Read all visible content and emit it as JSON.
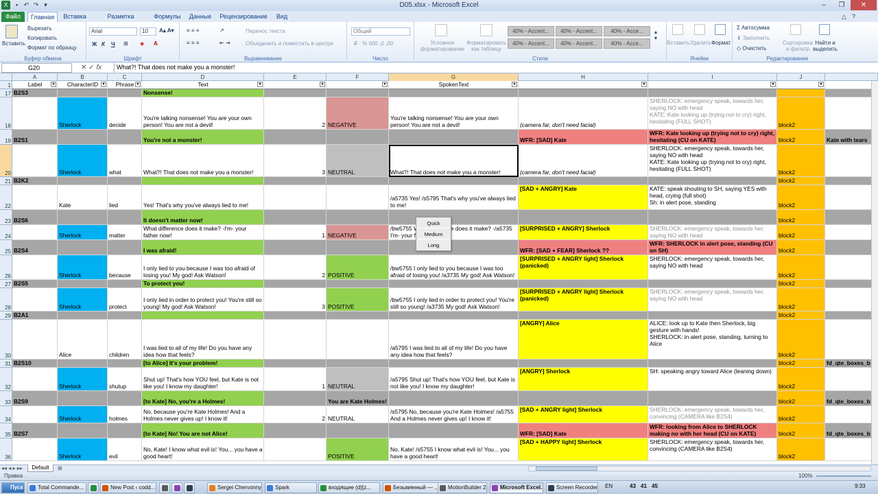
{
  "window": {
    "title": "D05.xlsx - Microsoft Excel"
  },
  "tabs": [
    "Файл",
    "Главная",
    "Вставка",
    "Разметка страницы",
    "Формулы",
    "Данные",
    "Рецензирование",
    "Вид"
  ],
  "ribbon": {
    "paste": "Вставить",
    "cut": "Вырезать",
    "copy": "Копировать",
    "format_painter": "Формат по образцу",
    "clipboard_group": "Буфер обмена",
    "font_name": "Arial",
    "font_size": "10",
    "font_group": "Шрифт",
    "wrap_text": "Перенос текста",
    "merge_center": "Объединить и поместить в центре",
    "alignment_group": "Выравнивание",
    "number_format": "Общий",
    "number_group": "Число",
    "conditional_formatting": "Условное форматирование",
    "format_as_table": "Форматировать как таблицу",
    "styles": [
      "40% - Accent...",
      "40% - Accent...",
      "40% - Acce...",
      "40% - Accent...",
      "40% - Accent...",
      "40% - Acce..."
    ],
    "styles_group": "Стили",
    "insert": "Вставить",
    "delete": "Удалить",
    "format": "Формат",
    "cells_group": "Ячейки",
    "autosum": "Автосумма",
    "fill": "Заполнить",
    "clear": "Очистить",
    "sort_filter": "Сортировка и фильтр",
    "find_select": "Найти и выделить",
    "editing_group": "Редактирование"
  },
  "formula_bar": {
    "name_box": "G20",
    "fx": "fx",
    "value": "What?! That does not make you a monster!"
  },
  "columns": [
    "A",
    "B",
    "C",
    "D",
    "E",
    "F",
    "G",
    "H",
    "I",
    "J"
  ],
  "header_row": {
    "num": "1",
    "cells": [
      "Label",
      "CharacterID",
      "Phrase",
      "Text",
      "",
      "",
      "SpokenText",
      "",
      "",
      ""
    ]
  },
  "colors": {
    "green": "#92d050",
    "blue": "#00b0f0",
    "gray_row": "#a6a6a6",
    "red": "#f08080",
    "pink": "#da9694",
    "lightgray": "#bfbfbf",
    "yellow": "#ffff00",
    "orange": "#ffc000",
    "selected_header": "#f9d99f"
  },
  "rows": [
    {
      "num": "17",
      "kind": "group",
      "label": "B2S3",
      "D": "Nonsense!",
      "J": "",
      "K": ""
    },
    {
      "num": "18",
      "kind": "data",
      "B": "Sherlock",
      "C": "decide",
      "D": "You're talking nonsense! You are your own person! You are not a devil!",
      "E": "2",
      "F": "NEGATIVE",
      "Fc": "pink",
      "G": "You're talking nonsense! You are your own person! You are not a devil!",
      "H": "(camera far, don't need facial)",
      "Hc": "",
      "I": "SHERLOCK: emergency speak, towards her, saying NO with head\nKATE: Kate looking up (trying not to cry) right, hesitating (FULL SHOT)",
      "Ig": true,
      "J": "block2"
    },
    {
      "num": "19",
      "kind": "group",
      "label": "B2S1",
      "D": "You're not a monster!",
      "H": "WFR: [SAD] Kate",
      "Hc": "red",
      "I": "WFR: Kate looking up (trying not to cry) right, hesitating (CU on KATE)",
      "Ic": "red",
      "J": "block2",
      "K": "Kate with tears"
    },
    {
      "num": "20",
      "kind": "data",
      "sel": true,
      "B": "Sherlock",
      "C": "what",
      "D": "What?! That does not make you a monster!",
      "E": "3",
      "F": "NEUTRAL",
      "Fc": "lightgray",
      "G": "What?! That does not make you a monster!",
      "H": "(camera far, don't need facial)",
      "Hc": "",
      "I": "SHERLOCK: emergency speak, towards her, saying NO with head\nKATE: Kate looking up (trying not to cry) right, hesitating (FULL SHOT)",
      "J": "block2"
    },
    {
      "num": "21",
      "kind": "group",
      "label": "B2K2",
      "D": "",
      "J": "block2"
    },
    {
      "num": "22",
      "kind": "data",
      "Bw": true,
      "B": "Kate",
      "C": "lied",
      "D": "Yes! That's why you've always lied to me!",
      "E": "",
      "F": "",
      "Fc": "",
      "G": "/a5735 Yes! /s5795 That's why you've always lied to me!",
      "H": "[SAD + ANGRY] Kate",
      "Hc": "yellow",
      "I": "KATE: speak shouting to SH, saying YES with head, crying (full shot)\nSh: in alert pose, standing",
      "J": "block2"
    },
    {
      "num": "23",
      "kind": "group",
      "label": "B2S6",
      "D": "It doesn't matter now!",
      "J": "block2"
    },
    {
      "num": "24",
      "kind": "data",
      "B": "Sherlock",
      "C": "matter",
      "D": "What difference does it make? -I'm- your father now!",
      "E": "1",
      "F": "NEGATIVE",
      "Fc": "pink",
      "G": "/bw5755 What difference does it make? -/a5735 I'm- your father now!",
      "H": "[SURPRISED + ANGRY] Sherlock",
      "Hc": "yellow",
      "I": "SHERLOCK: emergency speak, towards her, saying NO with head",
      "Ig": true,
      "J": "block2"
    },
    {
      "num": "25",
      "kind": "group",
      "label": "B2S4",
      "D": "I was afraid!",
      "H": "WFR: [SAD + FEAR] Sherlock ??",
      "Hc": "red",
      "I": "WFR: SHERLOCK in alert pose, standing (CU on SH)",
      "Ic": "red",
      "J": "block2"
    },
    {
      "num": "26",
      "kind": "data",
      "B": "Sherlock",
      "C": "because",
      "D": "I only lied to you because I was too afraid of losing you! My god! Ask Watson!",
      "E": "2",
      "F": "POSITIVE",
      "Fc": "green",
      "G": "/bw5755 I only lied to you because I was too afraid of losing you! /a3735 My god! Ask Watson!",
      "H": "[SURPRISED + ANGRY light] Sherlock (panicked)",
      "Hc": "yellow",
      "I": "SHERLOCK: emergency speak, towards her, saying NO with head",
      "J": "block2"
    },
    {
      "num": "27",
      "kind": "group",
      "label": "B2S5",
      "D": "To protect you!",
      "J": "block2"
    },
    {
      "num": "28",
      "kind": "data",
      "B": "Sherlock",
      "C": "protect",
      "D": "I only lied in order to protect you! You're still so young! My god! Ask Watson!",
      "E": "3",
      "F": "POSITIVE",
      "Fc": "green",
      "G": "/bw5755 I only lied in order to protect you! You're still so young! /a3735 My god! Ask Watson!",
      "H": "[SURPRISED + ANGRY light] Sherlock (panicked)",
      "Hc": "yellow",
      "I": "SHERLOCK: emergency speak, towards her, saying NO with head",
      "Ig": true,
      "J": "block2"
    },
    {
      "num": "29",
      "kind": "group",
      "label": "B2A1",
      "D": "",
      "J": "block2"
    },
    {
      "num": "30",
      "kind": "data",
      "Bw": true,
      "B": "Alice",
      "C": "children",
      "D": "I was lied to all of my life! Do you have any idea how that feels?",
      "E": "",
      "F": "",
      "Fc": "",
      "G": "/a5795 I was lied to all of my life! Do you have any idea how that feels?",
      "H": "[ANGRY] Alice",
      "Hc": "yellow",
      "I": "ALICE: look up to Kate then Sherlock, big gesture with hands!\nSHERLOCK: in alert pose, standing, turning to Alice",
      "J": "block2"
    },
    {
      "num": "31",
      "kind": "group",
      "label": "B2S10",
      "D": "[to Alice] It's your problem!",
      "J": "block2",
      "K": "fd_qte_boxes_b"
    },
    {
      "num": "32",
      "kind": "data",
      "B": "Sherlock",
      "C": "shutup",
      "D": "Shut up! That's how YOU feel, but Kate is not like you! I know my daughter!",
      "E": "1",
      "F": "NEUTRAL",
      "Fc": "lightgray",
      "G": "/a5795 Shut up! That's how YOU feel, but Kate is not like you! I know my daughter!",
      "H": "[ANGRY] Sherlock",
      "Hc": "yellow",
      "I": "SH: speaking angry toward Alice (leaning down)",
      "J": "block2"
    },
    {
      "num": "33",
      "kind": "group",
      "label": "B2S9",
      "D": "[to Kate] No, you're a Holmes!",
      "F": "You are Kate Holmes!",
      "J": "block2",
      "K": "fd_qte_boxes_b"
    },
    {
      "num": "34",
      "kind": "data",
      "B": "Sherlock",
      "C": "holmes",
      "D": "No, because you're Kate Holmes! And a Holmes never gives up! I know it!",
      "E": "2",
      "F": "NEUTRAL",
      "Fc": "",
      "G": "/s5795 No, because you're Kate Holmes! /a5755 And a Holmes never gives up! I know it!",
      "H": "[SAD + ANGRY light] Sherlock",
      "Hc": "yellow",
      "I": "SHERLOCK: emergency speak, towards her, convincing (CAMERA like B2S4)",
      "Ig": true,
      "J": "block2"
    },
    {
      "num": "35",
      "kind": "group",
      "label": "B2S7",
      "D": "[to Kate] No! You are not Alice!",
      "H": "WFR: [SAD] Kate",
      "Hc": "red",
      "I": "WFR: looking from Alice to SHERLOCK making no with her head (CU on KATE)",
      "Ic": "red",
      "J": "block2",
      "K": "fd_qte_boxes_b"
    },
    {
      "num": "36",
      "kind": "data",
      "B": "Sherlock",
      "C": "evil",
      "D": "No, Kate! I know what evil is! You... you have a good heart!",
      "E": "",
      "F": "POSITIVE",
      "Fc": "green",
      "G": "No, Kate! /s5755 I know what evil is! You... you have a good heart!",
      "H": "[SAD + HAPPY light] Sherlock",
      "Hc": "yellow",
      "I": "SHERLOCK: emergency speak, towards her, convincing (CAMERA like B2S4)",
      "J": "block2"
    }
  ],
  "popup": [
    "Quick",
    "Medium",
    "Long"
  ],
  "sheet_tab": "Default",
  "status": {
    "mode": "Правка",
    "zoom": "100%"
  },
  "taskbar": {
    "start": "Пуск",
    "items": [
      "Total Commande...",
      "",
      "New Post ‹ codd...",
      "",
      "Sergei Chervonnyi",
      "Spark",
      "входящие (d)[z...",
      "Безымянный — ...",
      "MotionBuilder 20...",
      "Microsoft Excel...",
      "Screen Recorder"
    ],
    "lang": "EN",
    "tray": [
      "43",
      "41",
      "45"
    ],
    "clock": "9:33"
  }
}
